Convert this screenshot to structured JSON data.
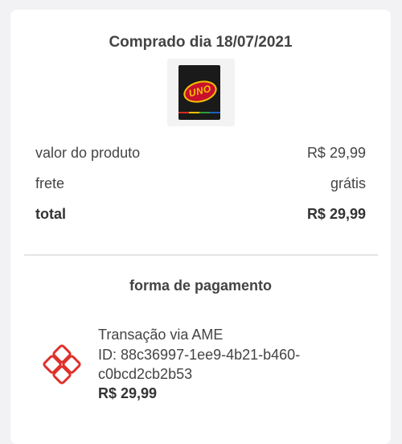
{
  "purchase": {
    "title": "Comprado dia 18/07/2021",
    "product_image_alt": "UNO"
  },
  "summary": {
    "rows": [
      {
        "label": "valor do produto",
        "value": "R$ 29,99"
      },
      {
        "label": "frete",
        "value": "grátis"
      },
      {
        "label": "total",
        "value": "R$ 29,99"
      }
    ]
  },
  "payment": {
    "title": "forma de pagamento",
    "method": "Transação via AME",
    "id_line1": "ID: 88c36997-1ee9-4b21-b460-",
    "id_line2": "c0bcd2cb2b53",
    "amount": "R$ 29,99",
    "icon": "ame-icon",
    "accent_color": "#e0302a"
  }
}
